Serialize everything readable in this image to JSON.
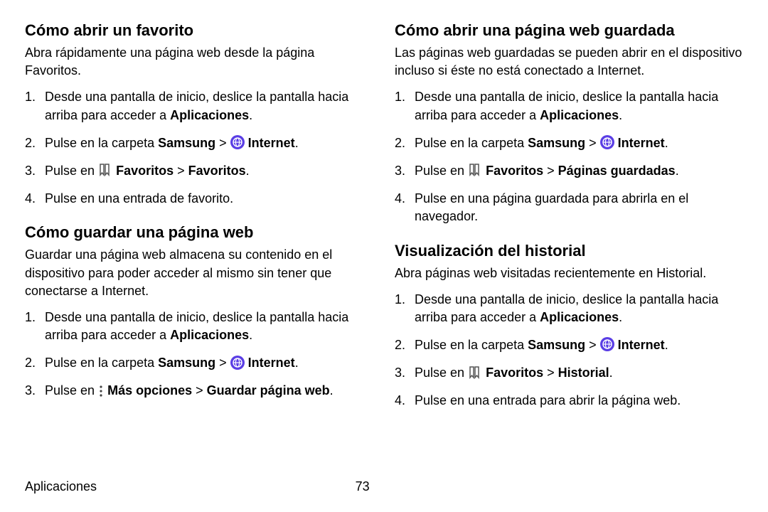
{
  "left": {
    "sec1": {
      "title": "Cómo abrir un favorito",
      "intro": "Abra rápidamente una página web desde la página Favoritos.",
      "step1a": "Desde una pantalla de inicio, deslice la pantalla hacia arriba para acceder a ",
      "step1b": "Aplicaciones",
      "step1c": ".",
      "step2a": "Pulse en la carpeta ",
      "step2b": "Samsung",
      "step2c": " > ",
      "step2d": "Internet",
      "step2e": ".",
      "step3a": "Pulse en ",
      "step3b": "Favoritos",
      "step3c": " > ",
      "step3d": "Favoritos",
      "step3e": ".",
      "step4": "Pulse en una entrada de favorito."
    },
    "sec2": {
      "title": "Cómo guardar una página web",
      "intro": "Guardar una página web almacena su contenido en el dispositivo para poder acceder al mismo sin tener que conectarse a Internet.",
      "step1a": "Desde una pantalla de inicio, deslice la pantalla hacia arriba para acceder a ",
      "step1b": "Aplicaciones",
      "step1c": ".",
      "step2a": "Pulse en la carpeta ",
      "step2b": "Samsung",
      "step2c": " > ",
      "step2d": "Internet",
      "step2e": ".",
      "step3a": "Pulse en ",
      "step3b": "Más opciones",
      "step3c": " > ",
      "step3d": "Guardar página web",
      "step3e": "."
    }
  },
  "right": {
    "sec1": {
      "title": "Cómo abrir una página web guardada",
      "intro": "Las páginas web guardadas se pueden abrir en el dispositivo incluso si éste no está conectado a Internet.",
      "step1a": "Desde una pantalla de inicio, deslice la pantalla hacia arriba para acceder a ",
      "step1b": "Aplicaciones",
      "step1c": ".",
      "step2a": "Pulse en la carpeta ",
      "step2b": "Samsung",
      "step2c": " > ",
      "step2d": "Internet",
      "step2e": ".",
      "step3a": "Pulse en ",
      "step3b": "Favoritos",
      "step3c": " > ",
      "step3d": "Páginas guardadas",
      "step3e": ".",
      "step4": "Pulse en una página guardada para abrirla en el navegador."
    },
    "sec2": {
      "title": "Visualización del historial",
      "intro": "Abra páginas web visitadas recientemente en Historial.",
      "step1a": "Desde una pantalla de inicio, deslice la pantalla hacia arriba para acceder a ",
      "step1b": "Aplicaciones",
      "step1c": ".",
      "step2a": "Pulse en la carpeta ",
      "step2b": "Samsung",
      "step2c": " > ",
      "step2d": "Internet",
      "step2e": ".",
      "step3a": "Pulse en ",
      "step3b": "Favoritos",
      "step3c": " > ",
      "step3d": "Historial",
      "step3e": ".",
      "step4": "Pulse en una entrada para abrir la página web."
    }
  },
  "footer": {
    "label": "Aplicaciones",
    "pagenum": "73"
  }
}
